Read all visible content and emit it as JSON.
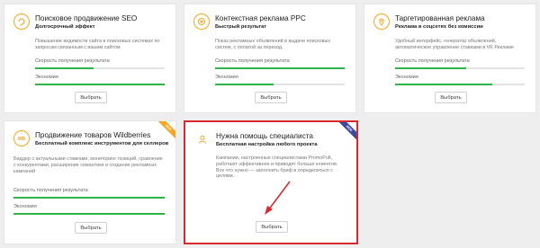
{
  "cards": [
    {
      "title": "Поисковое продвижение SEO",
      "subtitle": "Долгосрочный эффект",
      "description": "Повышение видимости сайта в поисковых системах по запросам связанным с вашим сайтом",
      "metric1_label": "Скорость получения результата",
      "metric1_value": 0.45,
      "metric2_label": "Экономия",
      "metric2_value": 1.0,
      "button": "Выбрать",
      "icon": "seo-icon"
    },
    {
      "title": "Контекстная реклама PPC",
      "subtitle": "Быстрый результат",
      "description": "Показ рекламных объявлений в выдаче поисковых систем, с оплатой за переход.",
      "metric1_label": "Скорость получения результата",
      "metric1_value": 1.0,
      "metric2_label": "Экономия",
      "metric2_value": 0.45,
      "button": "Выбрать",
      "icon": "target-icon"
    },
    {
      "title": "Таргетированная реклама",
      "subtitle": "Реклама в соцсетях без комиссии",
      "description": "Удобный интерфейс, генератор объявлений, автоматическое управление ставками в VK Рекламе",
      "metric1_label": "Скорость получения результата",
      "metric1_value": 0.55,
      "metric2_label": "Экономия",
      "metric2_value": 0.75,
      "button": "Выбрать",
      "icon": "location-pin-icon"
    },
    {
      "title": "Продвижение товаров Wildberries",
      "subtitle": "Бесплатный комплекс инструментов для селлеров",
      "description": "Биддер с актуальными ставками, мониторинг позиций, сравнение с конкурентами, расширение семантики и создание рекламных кампаний",
      "metric1_label": "Скорость получения результата",
      "metric1_value": 1.0,
      "metric2_label": "Экономия",
      "metric2_value": 1.0,
      "button": "Выбрать",
      "icon": "wb-icon",
      "ribbon": "NEW"
    },
    {
      "title": "Нужна помощь специалиста",
      "subtitle": "Бесплатная настройка любого проекта",
      "description": "Кампании, настроенные специалистами PromoPult, работают эффективнее и приводят больше клиентов. Все что нужно — заполнить бриф и определиться с целями.",
      "button": "Выбрать",
      "icon": "person-icon",
      "ribbon": "NEW"
    }
  ],
  "colors": {
    "accent": "#f5a623",
    "progress": "#2fb34a",
    "highlight_border": "#d9282f",
    "ribbon_blue": "#3b4a9b",
    "arrow": "#d9282f"
  }
}
